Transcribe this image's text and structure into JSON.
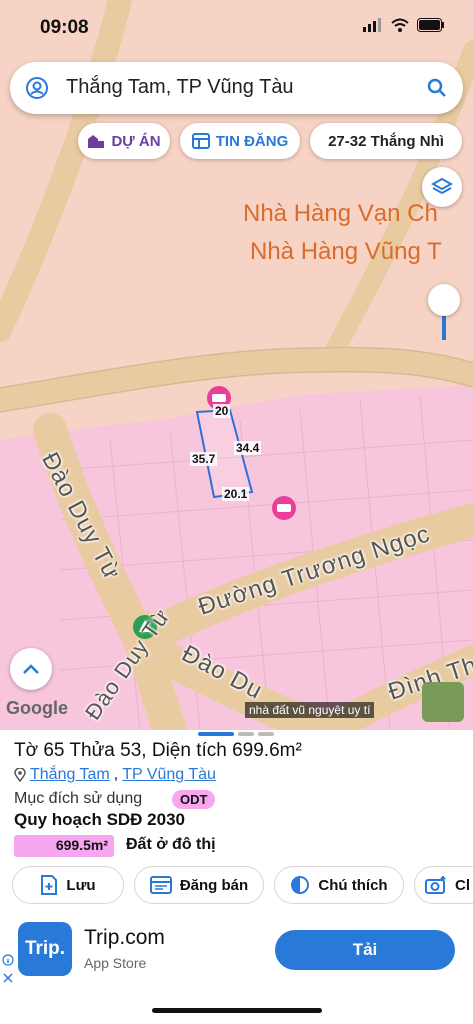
{
  "status": {
    "time": "09:08"
  },
  "search": {
    "query": "Thắng Tam, TP Vũng Tàu"
  },
  "chips": {
    "du_an": "DỰ ÁN",
    "tin_dang": "TIN ĐĂNG",
    "place": "27-32 Thắng Nhì"
  },
  "map": {
    "places": [
      "Nhà Hàng Vạn Ch",
      "Nhà Hàng Vũng T"
    ],
    "roads": {
      "dao_duy_tu_1": "Đào Duy Từ",
      "dao_duy_tu_2": "Đào Duy Từ",
      "truong_ngoc": "Đường Trương Ngọc",
      "dao_duy_short": "Đào Du",
      "dinh_th": "Đình Th"
    },
    "dims": {
      "top": "20",
      "left": "35.7",
      "right": "34.4",
      "bottom": "20.1"
    },
    "watermark": "nhà đất vũ nguyệt uy tí",
    "google": "Google"
  },
  "parcel": {
    "title": "Tờ 65 Thửa 53, Diện tích 699.6m²",
    "ward": "Thắng Tam",
    "city": "TP Vũng Tàu",
    "separator": ",",
    "usage_label": "Mục đích sử dụng",
    "usage_code": "ODT",
    "plan_title": "Quy hoạch SDĐ 2030",
    "plan_area": "699.5m²",
    "plan_type": "Đất ở đô thị"
  },
  "actions": {
    "save": "Lưu",
    "post": "Đăng bán",
    "legend": "Chú thích",
    "more": "Cl"
  },
  "ad": {
    "title": "Trip.com",
    "subtitle": "App Store",
    "logo": "Trip.",
    "cta": "Tải"
  },
  "colors": {
    "accent": "#2979d9",
    "purple": "#6b3fa0",
    "odt": "#f7a6f0",
    "zone": "#f9c2d6",
    "land": "#f6d1c1",
    "road": "#e8c9a0"
  }
}
